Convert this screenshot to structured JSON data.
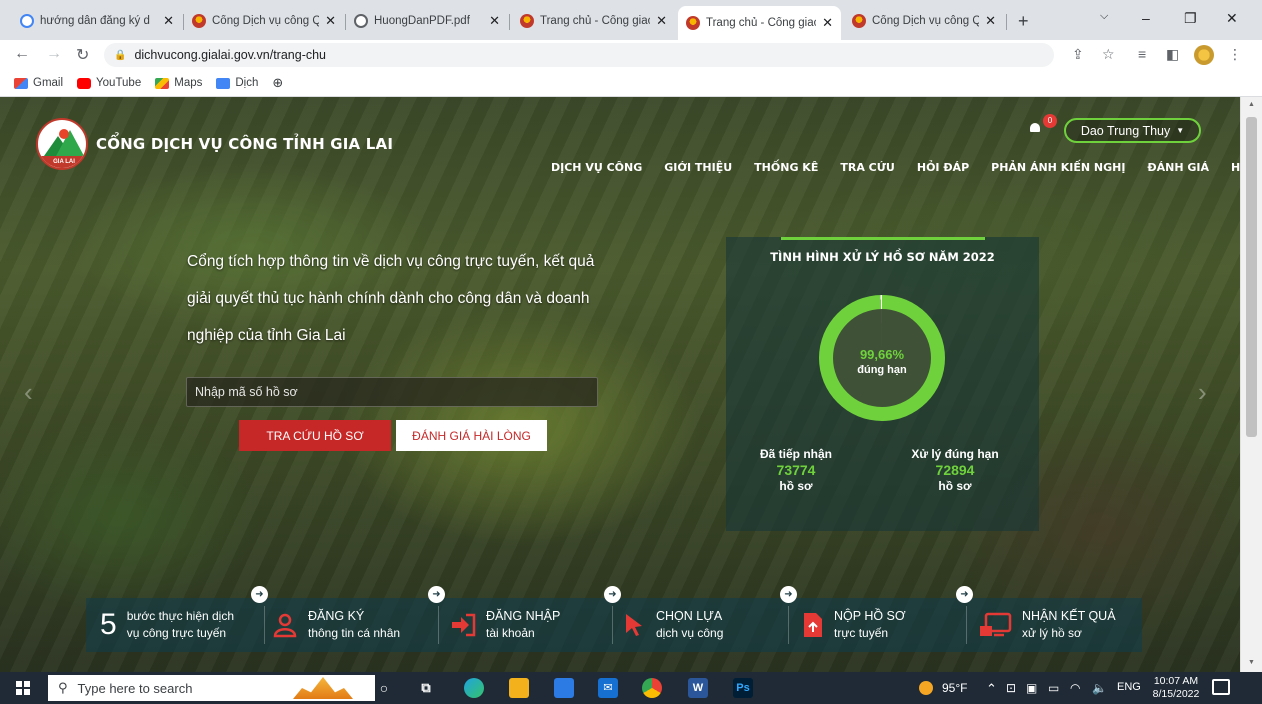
{
  "browser": {
    "tabs": [
      {
        "title": "hướng dẫn đăng ký d",
        "close": "✕"
      },
      {
        "title": "Cổng Dịch vụ công Q",
        "close": "✕"
      },
      {
        "title": "HuongDanPDF.pdf",
        "close": "✕"
      },
      {
        "title": "Trang chủ - Cổng giao",
        "close": "✕"
      },
      {
        "title": "Trang chủ - Cổng giao",
        "close": "✕"
      },
      {
        "title": "Cổng Dịch vụ công Q",
        "close": "✕"
      }
    ],
    "url": "dichvucong.gialai.gov.vn/trang-chu",
    "bookmarks": [
      "Gmail",
      "YouTube",
      "Maps",
      "Dịch"
    ]
  },
  "site": {
    "logo_text": "GIA LAI",
    "title": "CỔNG DỊCH VỤ CÔNG TỈNH GIA LAI",
    "notification_count": "0",
    "user_name": "Dao Trung Thuy",
    "nav": [
      "DỊCH VỤ CÔNG",
      "GIỚI THIỆU",
      "THỐNG KÊ",
      "TRA CỨU",
      "HỎI ĐÁP",
      "PHẢN ÁNH KIẾN NGHỊ",
      "ĐÁNH GIÁ",
      "HỖ TRỢ"
    ],
    "intro": "Cổng tích hợp thông tin về dịch vụ công trực tuyến, kết quả giải quyết thủ tục hành chính dành cho công dân và doanh nghiệp của tỉnh Gia Lai",
    "search_placeholder": "Nhập mã số hồ sơ",
    "btn_lookup": "TRA CỨU HỒ SƠ",
    "btn_rate": "ĐÁNH GIÁ HÀI LÒNG"
  },
  "stats": {
    "title": "TÌNH HÌNH XỬ LÝ HỒ SƠ NĂM 2022",
    "percent": "99,66%",
    "percent_value": 99.66,
    "percent_label": "đúng hạn",
    "received_label": "Đã tiếp nhận",
    "received_value": "73774",
    "received_unit": "hồ sơ",
    "ontime_label": "Xử lý đúng hạn",
    "ontime_value": "72894",
    "ontime_unit": "hồ sơ"
  },
  "steps": {
    "number": "5",
    "intro_line1": "bước thực hiện dịch",
    "intro_line2": "vụ công trực tuyến",
    "items": [
      {
        "title": "ĐĂNG KÝ",
        "sub": "thông tin cá nhân"
      },
      {
        "title": "ĐĂNG NHẬP",
        "sub": "tài khoản"
      },
      {
        "title": "CHỌN LỰA",
        "sub": "dịch vụ công"
      },
      {
        "title": "NỘP HỒ SƠ",
        "sub": "trực tuyến"
      },
      {
        "title": "NHẬN KẾT QUẢ",
        "sub": "xử lý hồ sơ"
      }
    ]
  },
  "taskbar": {
    "search_placeholder": "Type here to search",
    "weather": "95°F",
    "lang": "ENG",
    "time": "10:07 AM",
    "date": "8/15/2022"
  },
  "colors": {
    "accent_green": "#6fd23c",
    "primary_red": "#c62828"
  }
}
